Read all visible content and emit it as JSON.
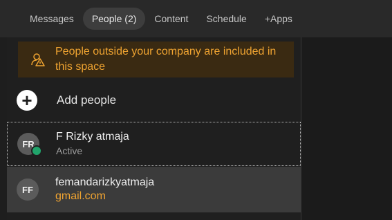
{
  "tabs": [
    {
      "label": "Messages",
      "active": false
    },
    {
      "label": "People (2)",
      "active": true
    },
    {
      "label": "Content",
      "active": false
    },
    {
      "label": "Schedule",
      "active": false
    },
    {
      "label": "+Apps",
      "active": false
    }
  ],
  "warning": {
    "icon": "external-people-warning-icon",
    "text": "People outside your company are included in this space",
    "color": "#f0a431",
    "background": "#3a2a12"
  },
  "add_people": {
    "label": "Add people",
    "icon": "plus-icon"
  },
  "people": [
    {
      "initials": "FR",
      "name": "F Rizky atmaja",
      "status": "Active",
      "status_color": "#21a46b"
    },
    {
      "initials": "FF",
      "name": "femandarizkyatmaja",
      "email_domain": "gmail.com"
    }
  ]
}
